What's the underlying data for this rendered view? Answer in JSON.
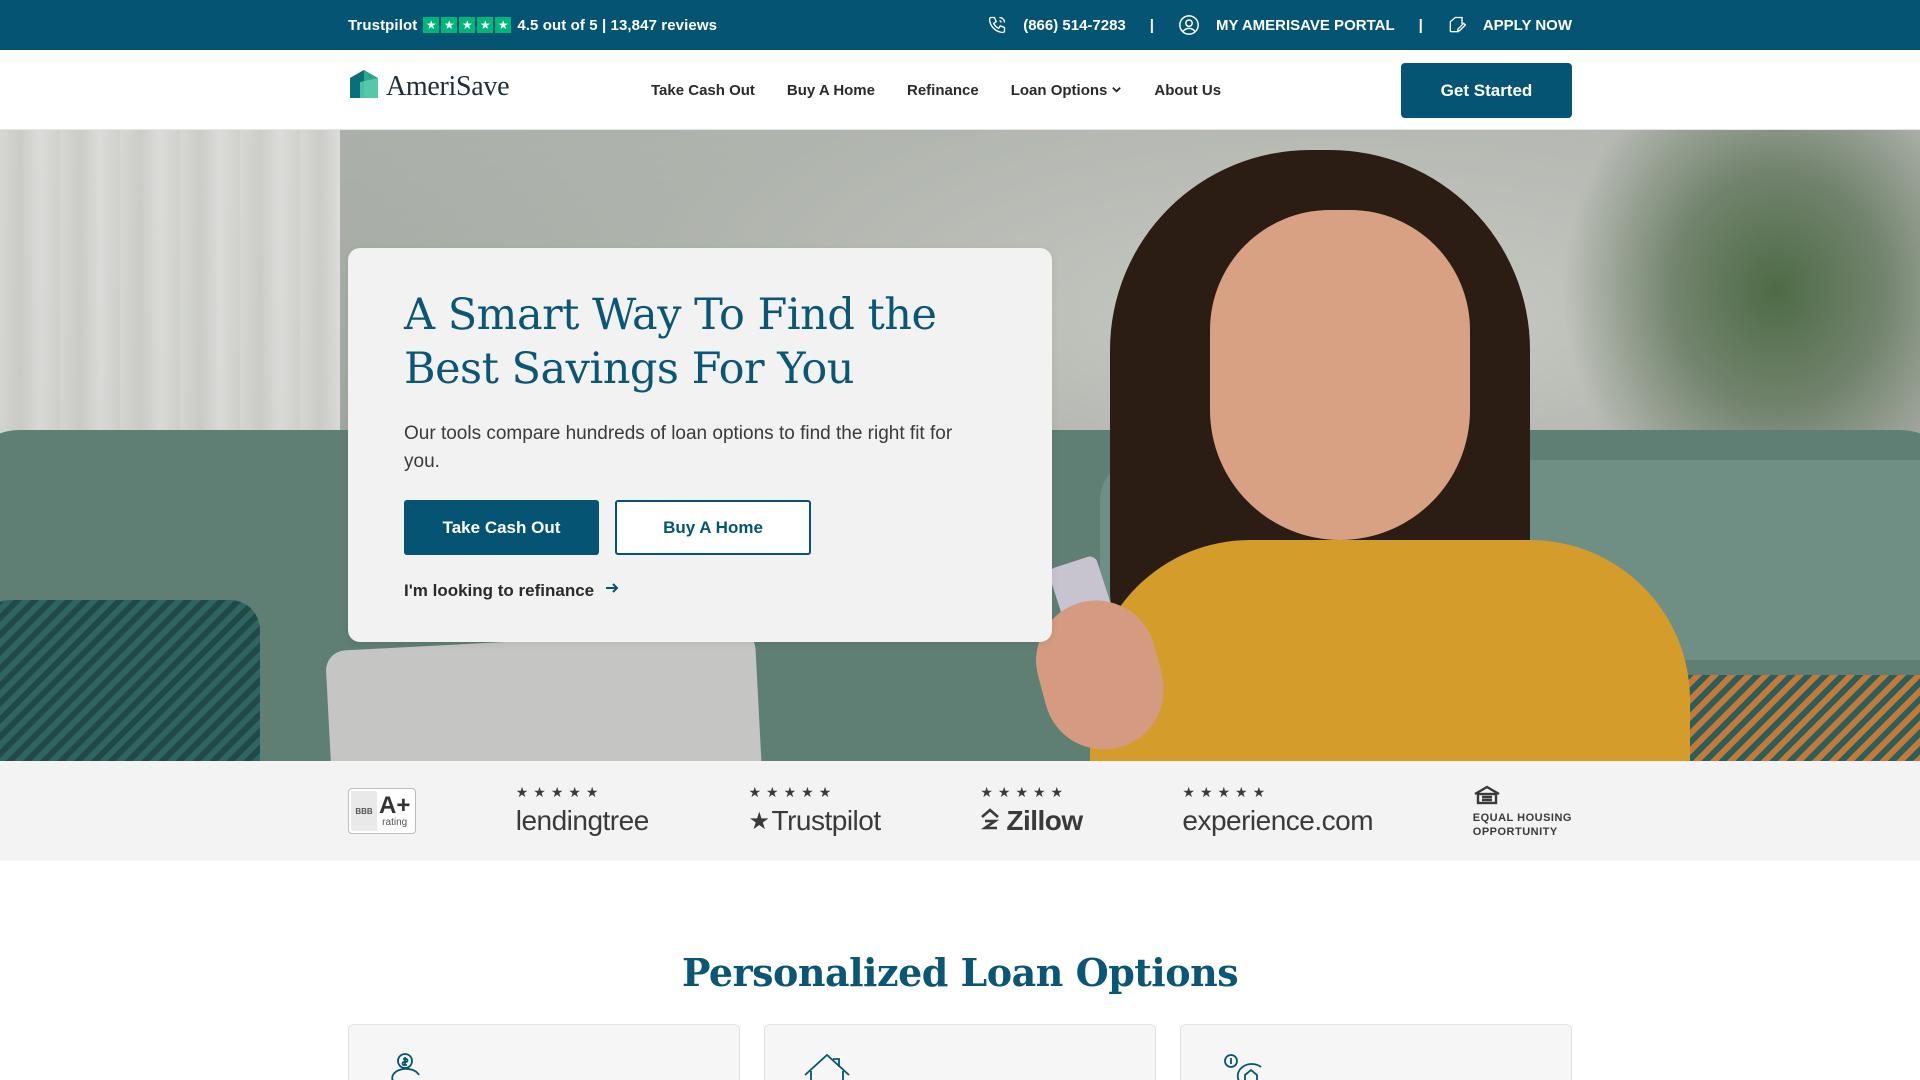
{
  "topbar": {
    "trustpilot_label": "Trustpilot",
    "rating_text": "4.5 out of 5 | 13,847 reviews",
    "phone": "(866) 514-7283",
    "separator": "|",
    "portal": "MY AMERISAVE PORTAL",
    "apply": "APPLY NOW",
    "icons": {
      "phone": "phone-icon",
      "portal": "user-circle-icon",
      "apply": "document-pen-icon",
      "star": "star-icon"
    }
  },
  "header": {
    "logo_text": "AmeriSave",
    "nav": [
      {
        "label": "Take Cash Out"
      },
      {
        "label": "Buy A Home"
      },
      {
        "label": "Refinance"
      },
      {
        "label": "Loan Options",
        "has_dropdown": true
      },
      {
        "label": "About Us"
      }
    ],
    "cta": "Get Started"
  },
  "hero": {
    "title": "A Smart Way To Find the Best Savings For You",
    "subtitle": "Our tools compare hundreds of loan options to find the right fit for you.",
    "primary_button": "Take Cash Out",
    "secondary_button": "Buy A Home",
    "refinance_link": "I'm looking to refinance"
  },
  "trust": {
    "bbb": {
      "seal": "BBB",
      "grade": "A+",
      "label": "rating"
    },
    "stars": "★★★★★",
    "logos": [
      {
        "name": "lendingtree"
      },
      {
        "name": "Trustpilot"
      },
      {
        "name": "Zillow"
      },
      {
        "name": "experience.com"
      }
    ],
    "eho_line1": "EQUAL HOUSING",
    "eho_line2": "OPPORTUNITY"
  },
  "section": {
    "title": "Personalized Loan Options",
    "cards": [
      {
        "icon": "piggy-bank-dollar-icon"
      },
      {
        "icon": "house-icon"
      },
      {
        "icon": "house-refresh-icon"
      }
    ]
  },
  "colors": {
    "brand_dark": "#065473",
    "heading": "#0b5675",
    "trustpilot_green": "#00b67a",
    "sweater": "#d39c2b"
  }
}
